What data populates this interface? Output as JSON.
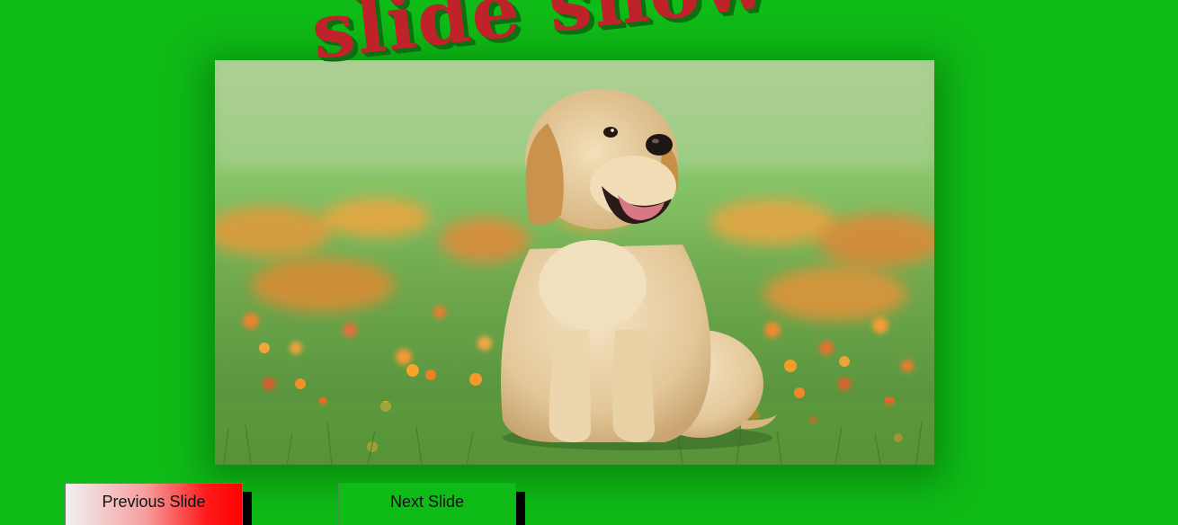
{
  "page": {
    "title": "slide show",
    "background_color": "#0fbb17",
    "title_color": "#c0222a"
  },
  "slideshow": {
    "current_slide": {
      "image_subject": "golden retriever puppy sitting in a field of grass and orange flowers"
    }
  },
  "controls": {
    "previous_label": "Previous Slide",
    "next_label": "Next Slide"
  }
}
